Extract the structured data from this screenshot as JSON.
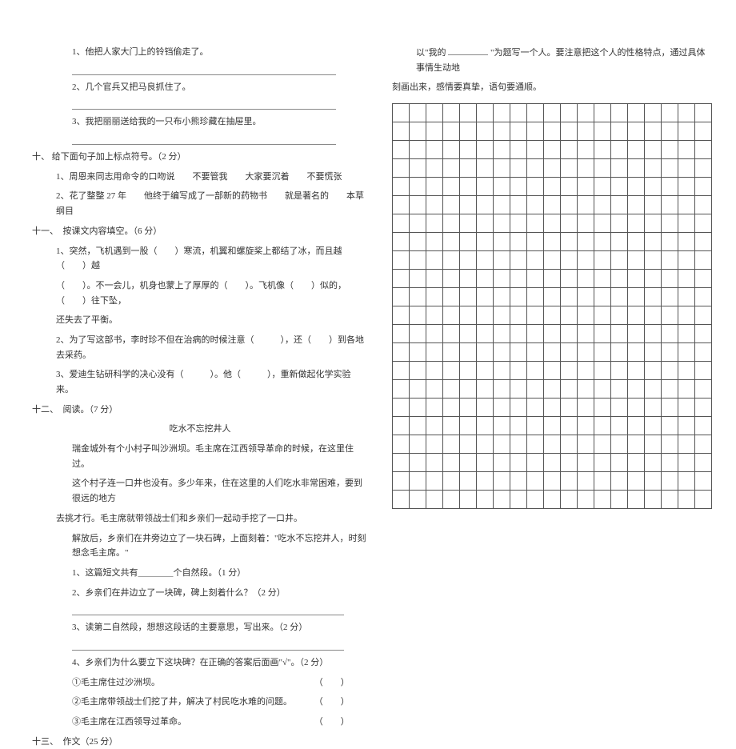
{
  "left": {
    "q1": "1、他把人家大门上的铃铛偷走了。",
    "q2": "2、几个官兵又把马良抓住了。",
    "q3": "3、我把丽丽送给我的一只布小熊珍藏在抽屉里。",
    "sec10_title": "十、 给下面句子加上标点符号。（2 分）",
    "sec10_1": "1、周恩来同志用命令的口吻说　　不要管我　　大家要沉着　　不要慌张",
    "sec10_2": "2、花了整整 27 年　　他终于编写成了一部新的药物书　　就是著名的　　本草纲目",
    "sec11_title": "十一、　按课文内容填空。（6 分）",
    "sec11_1a": "1、突然，飞机遇到一股（　　）寒流，机翼和螺旋桨上都结了冰，而且越（　　）越",
    "sec11_1b": "（　　）。不一会儿，机身也蒙上了厚厚的（　　）。飞机像（　　）似的，（　　）往下坠，",
    "sec11_1c": "还失去了平衡。",
    "sec11_2": "2、为了写这部书，李时珍不但在治病的时候注意（　　　），还（　　）到各地去采药。",
    "sec11_3": "3、爱迪生钻研科学的决心没有（　　　）。他（　　　），重新做起化学实验来。",
    "sec12_title": "十二、　阅读。（7 分）",
    "sec12_heading": "吃水不忘挖井人",
    "sec12_p1": "瑞金城外有个小村子叫沙洲坝。毛主席在江西领导革命的时候，在这里住过。",
    "sec12_p2": "这个村子连一口井也没有。多少年来，住在这里的人们吃水非常困难，要到很远的地方",
    "sec12_p2b": "去挑才行。毛主席就带领战士们和乡亲们一起动手挖了一口井。",
    "sec12_p3": "解放后，乡亲们在井旁边立了一块石碑，上面刻着：\"吃水不忘挖井人，时刻想念毛主席。\"",
    "sec12_q1": "1、这篇短文共有＿＿＿＿个自然段。（1 分）",
    "sec12_q2": "2、乡亲们在井边立了一块碑，碑上刻着什么？（2 分）",
    "sec12_q3": "3、读第二自然段，想想这段话的主要意思，写出来。（2 分）",
    "sec12_q4": "4、乡亲们为什么要立下这块碑？在正确的答案后面画\"√\"。（2 分）",
    "sec12_q4a": "①毛主席住过沙洲坝。",
    "sec12_q4b": "②毛主席带领战士们挖了井，解决了村民吃水难的问题。",
    "sec12_q4c": "③毛主席在江西领导过革命。",
    "sec13_title": "十三、　作文（25 分）"
  },
  "right": {
    "prompt1a": "以\"我的",
    "prompt1b": "\"为题写一个人。要注意把这个人的性格特点，通过具体事情生动地",
    "prompt2": "刻画出来，感情要真挚，语句要通顺。"
  },
  "grid": {
    "rows": 22,
    "cols": 19
  }
}
